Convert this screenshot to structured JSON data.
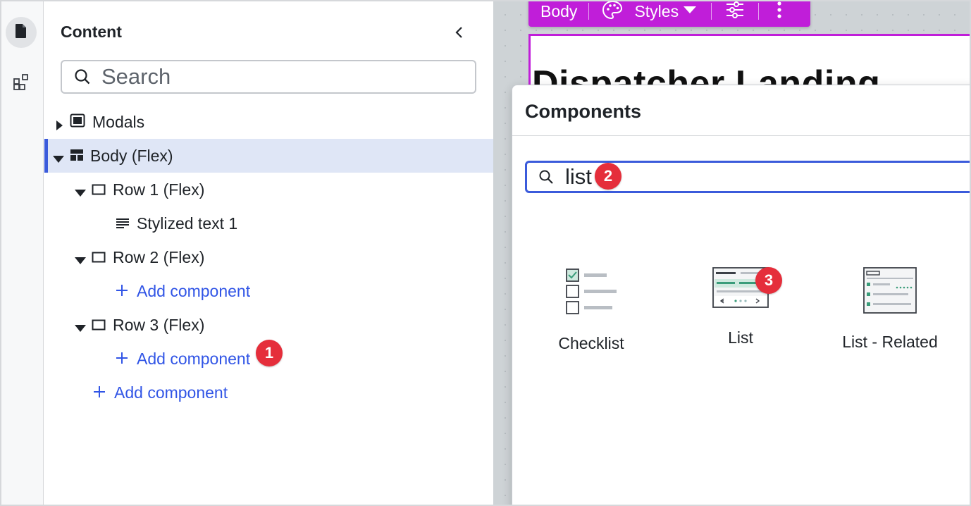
{
  "rail": {
    "items": [
      {
        "icon": "document-icon",
        "active": true
      },
      {
        "icon": "components-icon",
        "active": false
      }
    ]
  },
  "panel": {
    "title": "Content",
    "search_placeholder": "Search"
  },
  "tree": [
    {
      "label": "Modals",
      "icon": "modal-icon",
      "caret": "right",
      "depth": 0
    },
    {
      "label": "Body (Flex)",
      "icon": "layout-icon",
      "caret": "down",
      "depth": 0,
      "selected": true
    },
    {
      "label": "Row 1 (Flex)",
      "icon": "box-icon",
      "caret": "down",
      "depth": 1
    },
    {
      "label": "Stylized text 1",
      "icon": "text-lines-icon",
      "caret": "",
      "depth": 2
    },
    {
      "label": "Row 2 (Flex)",
      "icon": "box-icon",
      "caret": "down",
      "depth": 1
    },
    {
      "label": "Add component",
      "icon": "plus-icon",
      "depth": 2,
      "link": true
    },
    {
      "label": "Row 3 (Flex)",
      "icon": "box-icon",
      "caret": "down",
      "depth": 1
    },
    {
      "label": "Add component",
      "icon": "plus-icon",
      "depth": 2,
      "link": true
    },
    {
      "label": "Add component",
      "icon": "plus-icon",
      "depth": 1,
      "link": true
    }
  ],
  "toolbar": {
    "label": "Body",
    "styles_label": "Styles",
    "color": "#c01ed9"
  },
  "canvas": {
    "heading": "Dispatcher Landing"
  },
  "components": {
    "title": "Components",
    "search_value": "list",
    "items": [
      {
        "label": "Checklist",
        "thumb": "checklist-thumbnail"
      },
      {
        "label": "List",
        "thumb": "list-thumbnail"
      },
      {
        "label": "List - Related",
        "thumb": "list-related-thumbnail"
      }
    ]
  },
  "badges": [
    "1",
    "2",
    "3"
  ],
  "colors": {
    "accent": "#3b5bdb",
    "link": "#3155e6",
    "badge": "#e52e3b",
    "selection": "#dfe6f6"
  }
}
